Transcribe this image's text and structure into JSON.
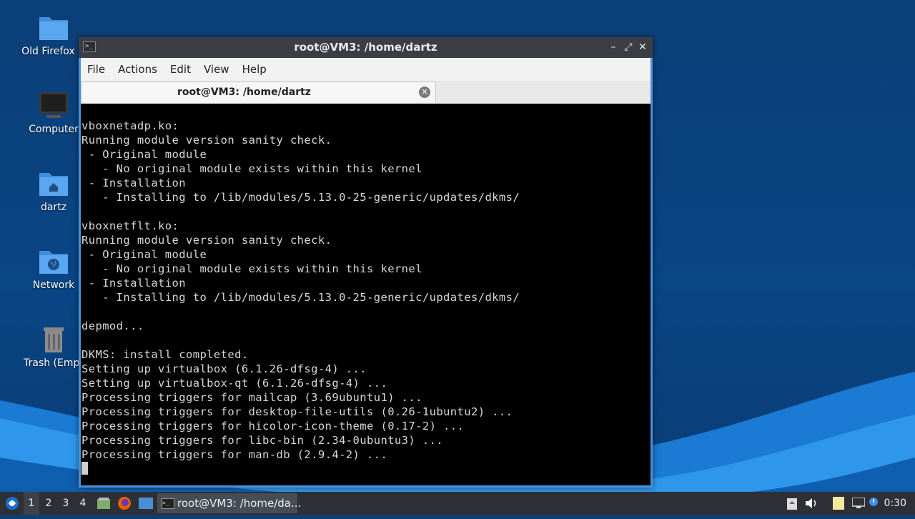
{
  "desktop": {
    "icons": [
      {
        "label": "Old Firefox D",
        "icon": "folder-icon"
      },
      {
        "label": "Computer",
        "icon": "computer-icon"
      },
      {
        "label": "dartz",
        "icon": "home-folder-icon"
      },
      {
        "label": "Network",
        "icon": "network-folder-icon"
      },
      {
        "label": "Trash (Empt",
        "icon": "trash-icon"
      }
    ]
  },
  "window": {
    "title": "root@VM3: /home/dartz",
    "controls": {
      "minimize": "–",
      "maximize": "⤢",
      "close": "✕"
    },
    "menu": [
      "File",
      "Actions",
      "Edit",
      "View",
      "Help"
    ],
    "tab": {
      "label": "root@VM3: /home/dartz",
      "close": "✕"
    },
    "terminal_lines": [
      "vboxnetadp.ko:",
      "Running module version sanity check.",
      " - Original module",
      "   - No original module exists within this kernel",
      " - Installation",
      "   - Installing to /lib/modules/5.13.0-25-generic/updates/dkms/",
      "",
      "vboxnetflt.ko:",
      "Running module version sanity check.",
      " - Original module",
      "   - No original module exists within this kernel",
      " - Installation",
      "   - Installing to /lib/modules/5.13.0-25-generic/updates/dkms/",
      "",
      "depmod...",
      "",
      "DKMS: install completed.",
      "Setting up virtualbox (6.1.26-dfsg-4) ...",
      "Setting up virtualbox-qt (6.1.26-dfsg-4) ...",
      "Processing triggers for mailcap (3.69ubuntu1) ...",
      "Processing triggers for desktop-file-utils (0.26-1ubuntu2) ...",
      "Processing triggers for hicolor-icon-theme (0.17-2) ...",
      "Processing triggers for libc-bin (2.34-0ubuntu3) ...",
      "Processing triggers for man-db (2.9.4-2) ..."
    ]
  },
  "taskbar": {
    "workspaces": [
      "1",
      "2",
      "3",
      "4"
    ],
    "active_workspace": "1",
    "task_label": "root@VM3: /home/da...",
    "clock": "0:30"
  },
  "colors": {
    "terminal_bg": "#000000",
    "terminal_fg": "#d8d8d8",
    "window_border": "#4a90d9",
    "titlebar": "#3b3f45",
    "taskbar": "#2d3035"
  }
}
